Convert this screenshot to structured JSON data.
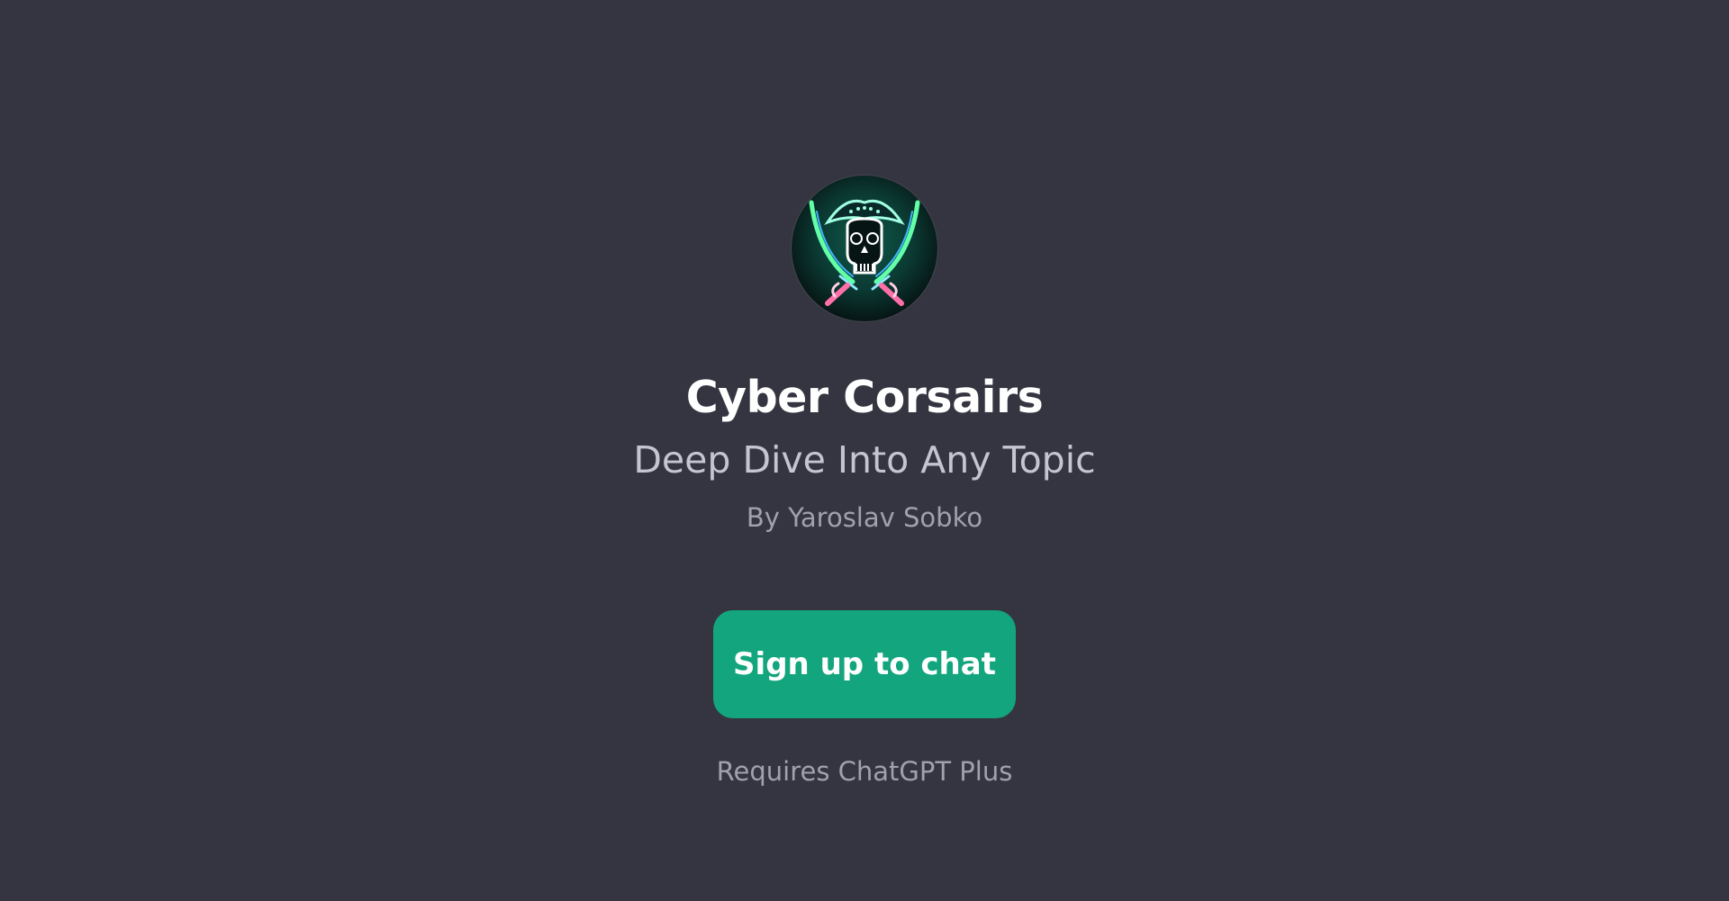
{
  "gpt": {
    "avatar_icon": "pirate-skull-crossed-swords-icon",
    "name": "Cyber Corsairs",
    "description": "Deep Dive Into Any Topic",
    "author": "By Yaroslav Sobko"
  },
  "cta": {
    "label": "Sign up to chat"
  },
  "requirement_note": "Requires ChatGPT Plus",
  "colors": {
    "background": "#343541",
    "button": "#13a57d",
    "title": "#ffffff",
    "subtitle": "#c5c5d2",
    "muted": "#a1a1ae"
  }
}
